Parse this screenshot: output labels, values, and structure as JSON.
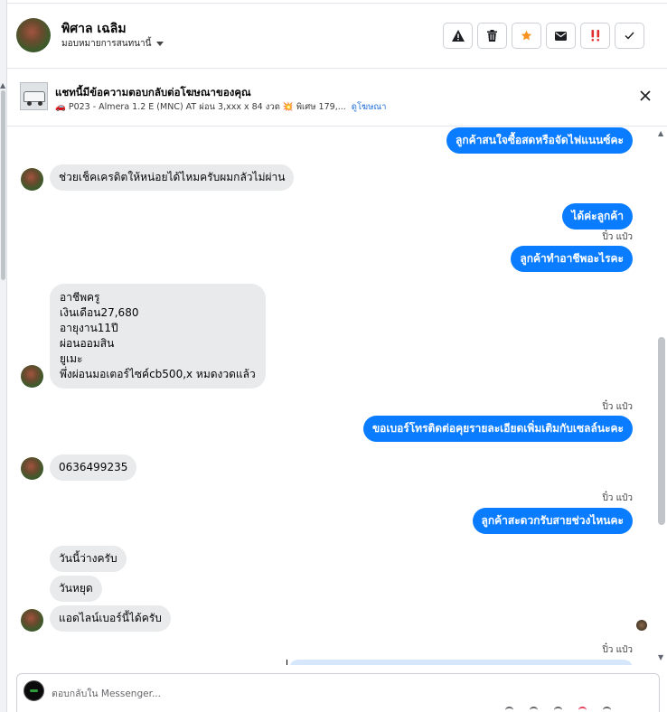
{
  "header": {
    "name": "พิศาล เฉลิม",
    "assign_label": "มอบหมายการสนทนานี้",
    "tools": [
      "warning-icon",
      "trash-icon",
      "star-icon",
      "mail-icon",
      "urgent-icon",
      "check-icon"
    ]
  },
  "ad": {
    "title": "แชทนี้มีข้อความตอบกลับต่อโฆษณาของคุณ",
    "car_emoji": "🚗",
    "detail": "P023 - Almera 1.2 E (MNC) AT ผ่อน 3,xxx x 84 งวด",
    "burst_emoji": "💥",
    "detail2": "พิเศษ 179,...",
    "link": "ดูโฆษณา"
  },
  "messages": {
    "m1": "ลูกค้าสนใจซื้อสดหรือจัดไฟแนนซ์คะ",
    "m2": "ช่วยเช็คเครดิตให้หน่อยได้ไหมครับผมกลัวไม่ผ่าน",
    "m3": "ได้ค่ะลูกค้า",
    "seen1": "ปิ๋ว แป๋ว",
    "m4": "ลูกค้าทำอาชีพอะไรคะ",
    "m5": "อาชีพครู\nเงินเดือน27,680\nอายุงาน11ปี\nผ่อนออมสิน\nยูเมะ\nพึ่งผ่อนมอเตอร์ไซค์cb500,x หมดงวดแล้ว",
    "seen2": "ปิ๋ว แป๋ว",
    "m6": "ขอเบอร์โทรติดต่อคุยรายละเอียดเพิ่มเติมกับเซลล์นะคะ",
    "m7": "0636499235",
    "seen3": "ปิ๋ว แป๋ว",
    "m8": "ลูกค้าสะดวกรับสายช่วงไหนคะ",
    "m9": "วันนี้ว่างครับ",
    "m10": "วันหยุด",
    "m11": "แอดไลน์เบอร์นี้ได้ครับ",
    "seen4": "ปิ๋ว แป๋ว"
  },
  "composer": {
    "placeholder": "ตอบกลับใน Messenger..."
  },
  "colors": {
    "outgoing_bubble": "#0a7cff",
    "incoming_bubble": "#e9eaeb",
    "star_accent": "#f7931e",
    "urgent_accent": "#e02d2d"
  }
}
